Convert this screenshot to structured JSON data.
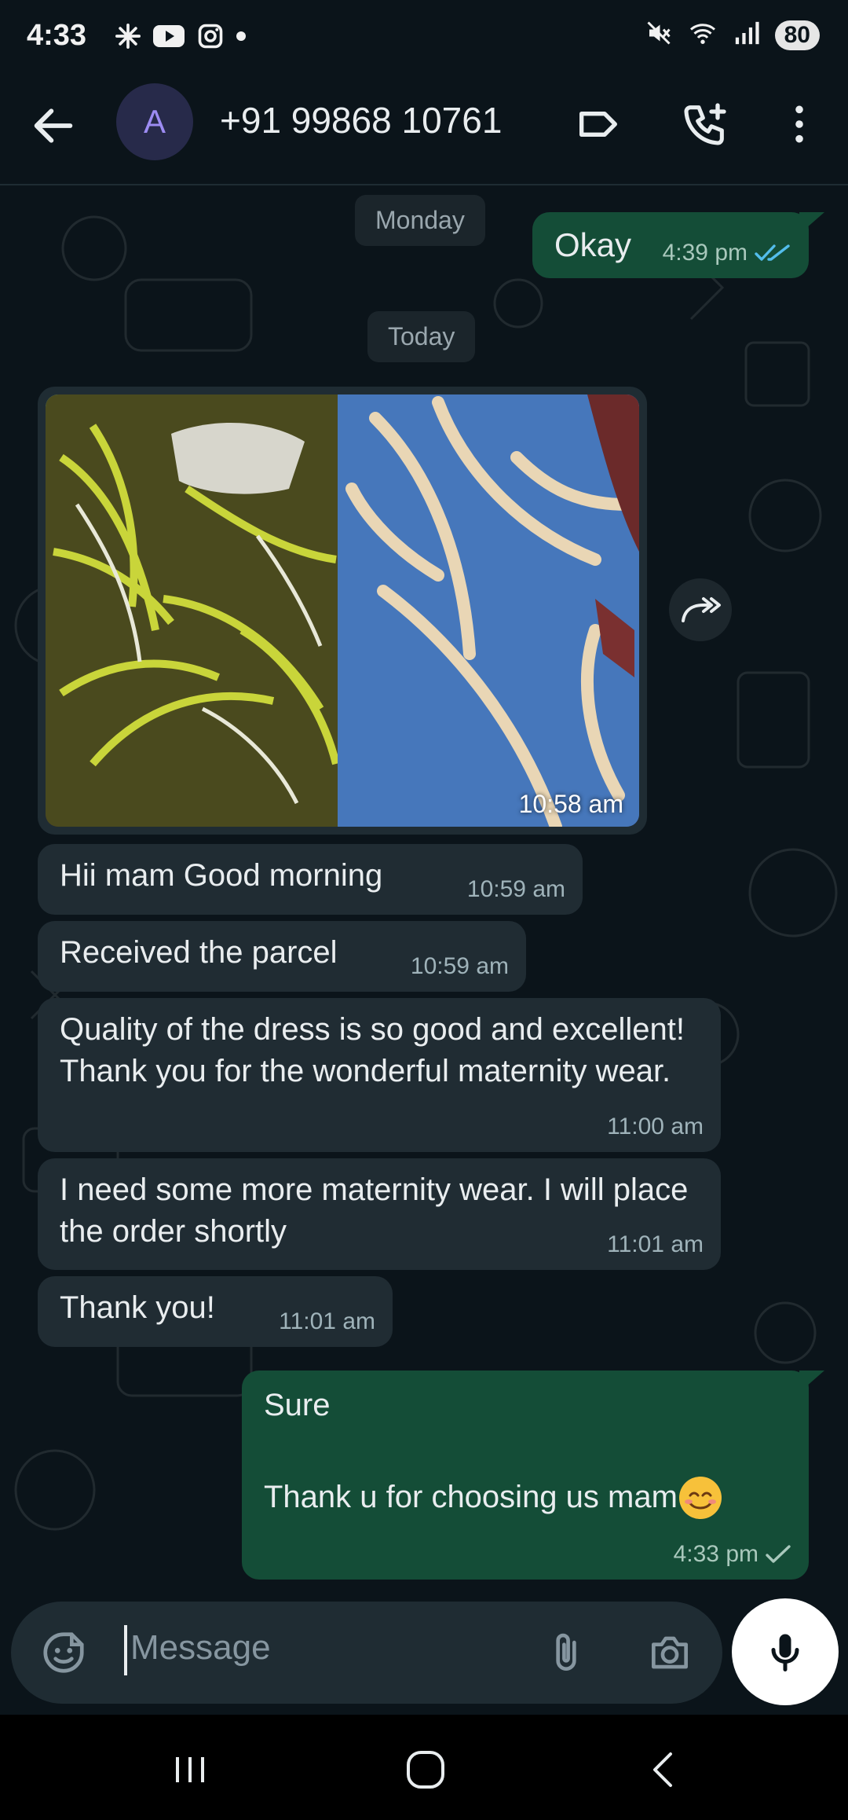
{
  "status_bar": {
    "time": "4:33",
    "battery": "80",
    "left_icons": [
      "pinwheel-icon",
      "youtube-icon",
      "instagram-icon",
      "dot-icon"
    ],
    "right_icons": [
      "mute-icon",
      "wifi-icon",
      "signal-icon"
    ]
  },
  "header": {
    "avatar_letter": "A",
    "contact": "+91 99868 10761",
    "icons": [
      "back-arrow-icon",
      "label-icon",
      "add-call-icon",
      "more-vert-icon"
    ]
  },
  "chat": {
    "date_monday": "Monday",
    "date_today": "Today",
    "messages": [
      {
        "dir": "out",
        "text": "Okay",
        "time": "4:39 pm",
        "status": "read"
      },
      {
        "dir": "in",
        "type": "image",
        "time": "10:58 am"
      },
      {
        "dir": "in",
        "text": "Hii mam Good morning",
        "time": "10:59 am"
      },
      {
        "dir": "in",
        "text": "Received the parcel",
        "time": "10:59 am"
      },
      {
        "dir": "in",
        "text": "Quality of the dress is so good and excellent! Thank you for the wonderful maternity wear.",
        "time": "11:00 am"
      },
      {
        "dir": "in",
        "text": "I need some more maternity wear. I will place the order shortly",
        "time": "11:01 am"
      },
      {
        "dir": "in",
        "text": "Thank you!",
        "time": "11:01 am"
      },
      {
        "dir": "out",
        "text_line1": "Sure",
        "text_line2": "Thank u for choosing us mam",
        "emoji": "😊",
        "time": "4:33 pm",
        "status": "sent"
      }
    ]
  },
  "input": {
    "placeholder": "Message"
  },
  "colors": {
    "background": "#0b141a",
    "incoming_bubble": "#202c33",
    "outgoing_bubble": "#144d37",
    "read_tick": "#53bdeb",
    "avatar_bg": "#272a4a",
    "avatar_fg": "#9d8cf3"
  }
}
